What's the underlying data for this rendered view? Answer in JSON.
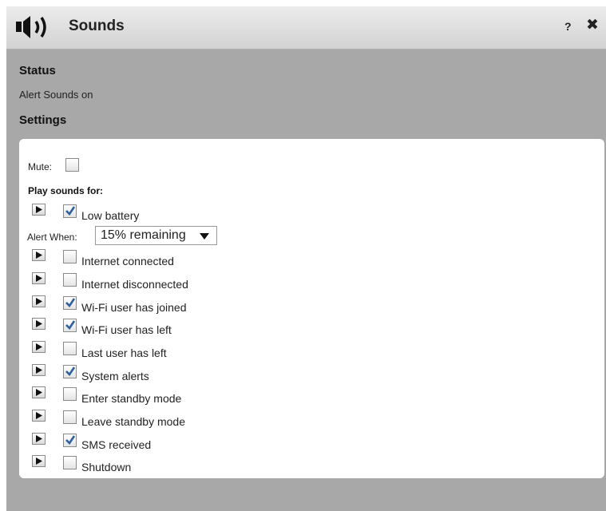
{
  "window": {
    "title": "Sounds",
    "help_label": "?",
    "close_label": "✖"
  },
  "status": {
    "heading": "Status",
    "text": "Alert Sounds on"
  },
  "settings": {
    "heading": "Settings",
    "mute_label": "Mute:",
    "mute_checked": false,
    "play_sounds_label": "Play sounds for:",
    "alert_when_label": "Alert When:",
    "alert_when_value": "15% remaining",
    "items": [
      {
        "label": "Low battery",
        "checked": true
      },
      {
        "label": "Internet connected",
        "checked": false
      },
      {
        "label": "Internet disconnected",
        "checked": false
      },
      {
        "label": "Wi-Fi user has joined",
        "checked": true
      },
      {
        "label": "Wi-Fi user has left",
        "checked": true
      },
      {
        "label": "Last user has left",
        "checked": false
      },
      {
        "label": "System alerts",
        "checked": true
      },
      {
        "label": "Enter standby mode",
        "checked": false
      },
      {
        "label": "Leave standby mode",
        "checked": false
      },
      {
        "label": "SMS received",
        "checked": true
      },
      {
        "label": "Shutdown",
        "checked": false
      }
    ]
  },
  "colors": {
    "background": "#a8a8a8",
    "panel": "#ffffff",
    "check": "#2d5f9e"
  },
  "icons": {
    "title": "speaker-icon",
    "play": "play-icon",
    "dropdown": "chevron-down-icon"
  }
}
